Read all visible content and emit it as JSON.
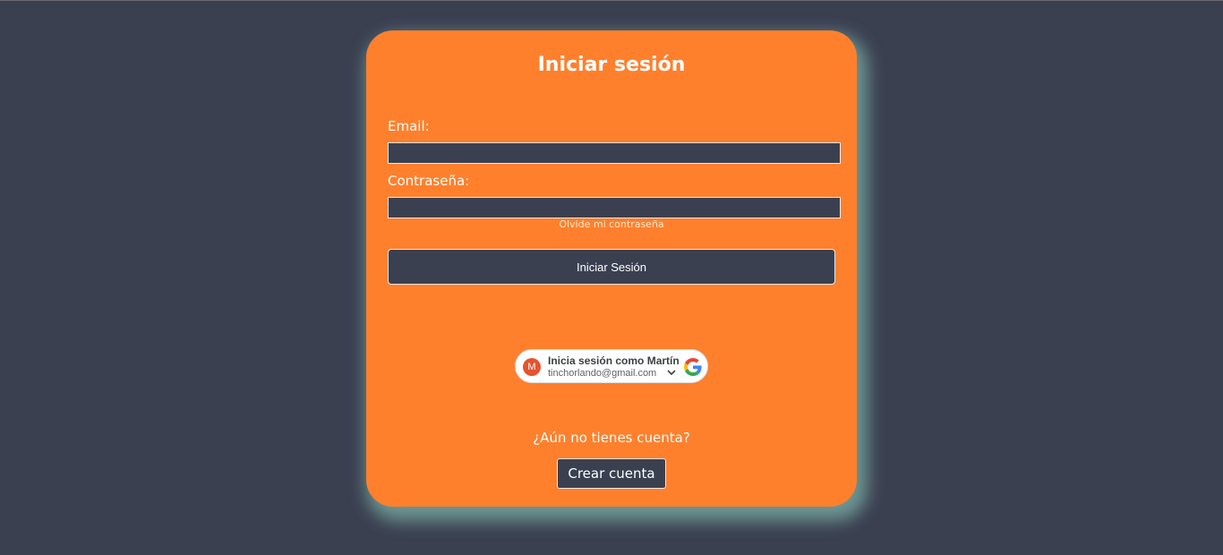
{
  "login": {
    "title": "Iniciar sesión",
    "email_label": "Email:",
    "email_value": "",
    "password_label": "Contraseña:",
    "password_value": "",
    "forgot_link": "Olvide mi contraseña",
    "submit_label": "Iniciar Sesión"
  },
  "google": {
    "avatar_letter": "M",
    "signin_label": "Inicia sesión como Martín",
    "email": "tinchorlando@gmail.com",
    "icon": "google-icon",
    "expand_icon": "chevron-down-icon"
  },
  "signup": {
    "prompt": "¿Aún no tienes cuenta?",
    "button_label": "Crear cuenta"
  },
  "colors": {
    "background": "#3b4051",
    "card": "#fe802d",
    "glow": "#96dcc8",
    "avatar": "#e4542f"
  }
}
